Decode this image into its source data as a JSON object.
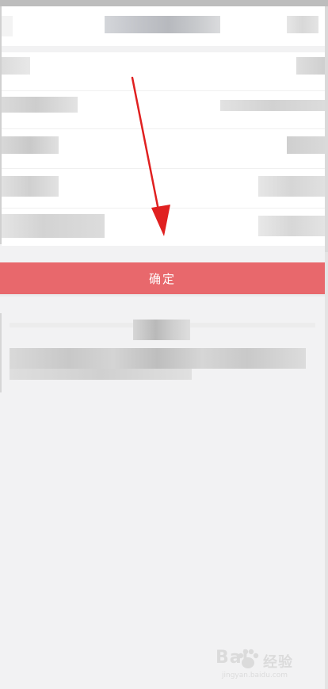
{
  "actions": {
    "confirm_label": "确定"
  },
  "colors": {
    "confirm_button": "#e8686c",
    "annotation_arrow": "#e02020",
    "background": "#f2f2f3"
  },
  "icons": {
    "annotation": "red-arrow-icon",
    "watermark_logo": "paw-logo-icon"
  },
  "watermark": {
    "brand": "Bai",
    "brand_suffix": "经验",
    "url": "jingyan.baidu.com"
  }
}
